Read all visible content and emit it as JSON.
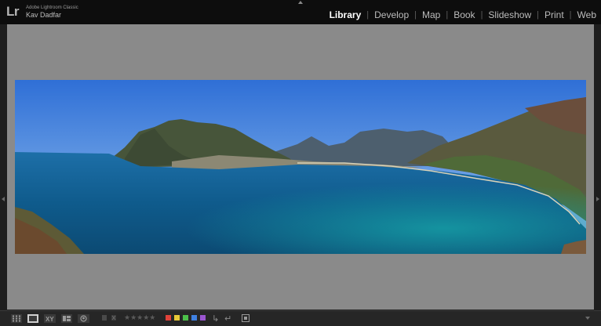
{
  "header": {
    "logo": "Lr",
    "app_name": "Adobe Lightroom Classic",
    "user_name": "Kav Dadfar",
    "separator": "|",
    "modules": [
      {
        "label": "Library",
        "active": true
      },
      {
        "label": "Develop",
        "active": false
      },
      {
        "label": "Map",
        "active": false
      },
      {
        "label": "Book",
        "active": false
      },
      {
        "label": "Slideshow",
        "active": false
      },
      {
        "label": "Print",
        "active": false
      },
      {
        "label": "Web",
        "active": false
      }
    ]
  },
  "main": {
    "view": "loupe",
    "photo_subject": "panorama-bay-mountains",
    "background_color": "#8a8a8a"
  },
  "toolbar": {
    "view_modes": [
      "grid-view-icon",
      "loupe-view-icon",
      "compare-view-icon",
      "survey-view-icon",
      "people-view-icon"
    ],
    "active_view": "loupe-view-icon",
    "stars": "★★★★★",
    "rating": 0,
    "color_labels": [
      "#e0423a",
      "#e8c938",
      "#4cc04a",
      "#3f80e0",
      "#9a55d0"
    ],
    "rotate_left": "↳",
    "rotate_right": "↵"
  }
}
